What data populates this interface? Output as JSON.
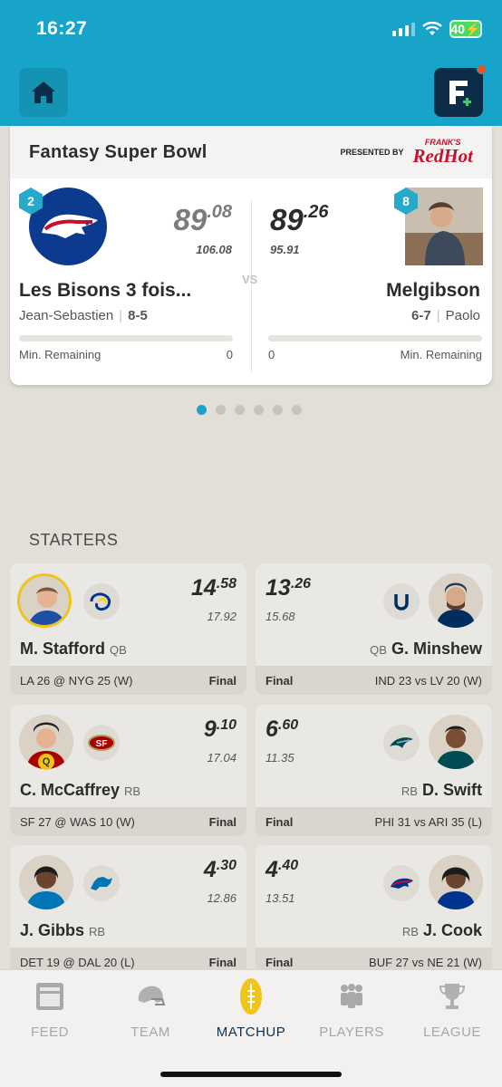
{
  "status_bar": {
    "time": "16:27",
    "battery": "40"
  },
  "matchup": {
    "title": "Fantasy Super Bowl",
    "sponsor": {
      "presented_by": "PRESENTED BY",
      "brand_top": "FRANK'S",
      "brand_main": "RedHot"
    },
    "vs": "VS",
    "left": {
      "seed": "2",
      "score_int": "89",
      "score_dec": ".08",
      "projected": "106.08",
      "name": "Les Bisons 3 fois...",
      "owner": "Jean-Sebastien",
      "record": "8-5",
      "min_label": "Min. Remaining",
      "min_value": "0",
      "progress": 0
    },
    "right": {
      "seed": "8",
      "score_int": "89",
      "score_dec": ".26",
      "projected": "95.91",
      "name": "Melgibson",
      "owner": "Paolo",
      "record": "6-7",
      "min_label": "Min. Remaining",
      "min_value": "0",
      "progress": 0
    },
    "page_dots": {
      "count": 6,
      "active": 1
    }
  },
  "starters": {
    "label": "STARTERS",
    "rows": [
      {
        "left": {
          "name": "M. Stafford",
          "pos": "QB",
          "pts_int": "14",
          "pts_dec": ".58",
          "proj": "17.92",
          "game": "LA 26 @ NYG 25 (W)",
          "status": "Final",
          "team_icon": "rams-logo-icon"
        },
        "right": {
          "name": "G. Minshew",
          "pos": "QB",
          "pts_int": "13",
          "pts_dec": ".26",
          "proj": "15.68",
          "game": "IND 23 vs LV 20 (W)",
          "status": "Final",
          "team_icon": "colts-logo-icon"
        }
      },
      {
        "left": {
          "name": "C. McCaffrey",
          "pos": "RB",
          "pts_int": "9",
          "pts_dec": ".10",
          "proj": "17.04",
          "game": "SF 27 @ WAS 10 (W)",
          "status": "Final",
          "team_icon": "49ers-logo-icon",
          "tag": "Q"
        },
        "right": {
          "name": "D. Swift",
          "pos": "RB",
          "pts_int": "6",
          "pts_dec": ".60",
          "proj": "11.35",
          "game": "PHI 31 vs ARI 35 (L)",
          "status": "Final",
          "team_icon": "eagles-logo-icon"
        }
      },
      {
        "left": {
          "name": "J. Gibbs",
          "pos": "RB",
          "pts_int": "4",
          "pts_dec": ".30",
          "proj": "12.86",
          "game": "DET 19 @ DAL 20 (L)",
          "status": "Final",
          "team_icon": "lions-logo-icon"
        },
        "right": {
          "name": "J. Cook",
          "pos": "RB",
          "pts_int": "4",
          "pts_dec": ".40",
          "proj": "13.51",
          "game": "BUF 27 vs NE 21 (W)",
          "status": "Final",
          "team_icon": "bills-logo-icon"
        }
      }
    ]
  },
  "tabs": [
    {
      "label": "FEED",
      "icon": "feed-icon",
      "active": false
    },
    {
      "label": "TEAM",
      "icon": "helmet-icon",
      "active": false
    },
    {
      "label": "MATCHUP",
      "icon": "football-icon",
      "active": true
    },
    {
      "label": "PLAYERS",
      "icon": "players-icon",
      "active": false
    },
    {
      "label": "LEAGUE",
      "icon": "trophy-icon",
      "active": false
    }
  ],
  "colors": {
    "header": "#18a3c9",
    "navy": "#10324f",
    "accent_dot": "#f04e23",
    "highlight": "#f0c419"
  }
}
